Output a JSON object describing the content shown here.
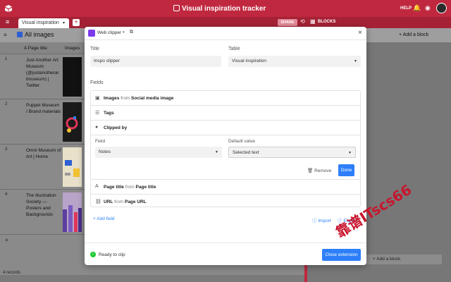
{
  "app": {
    "base_title": "Visual inspiration tracker",
    "help": "HELP"
  },
  "tabs": {
    "table_name": "Visual inspiration",
    "share_label": "SHARE",
    "blocks_label": "BLOCKS"
  },
  "view": {
    "name": "All images",
    "add_block": "Add a block"
  },
  "grid": {
    "col_title": "Page title",
    "col_images": "Images",
    "rows": [
      {
        "num": "1",
        "title": "Just Another Art Museum (@justanotherar tmuseum) | Twitter"
      },
      {
        "num": "2",
        "title": "Puppet Museum / Brand materials"
      },
      {
        "num": "3",
        "title": "Omni Museum of Art | Home"
      },
      {
        "num": "4",
        "title": "The Illustration Society — Posters and Backgrounds"
      }
    ],
    "record_count": "4 records",
    "add_row": "+"
  },
  "blocks_panel": {
    "add_block": "Add a block"
  },
  "modal": {
    "extension_name": "Web clipper",
    "title_label": "Title",
    "title_value": "Inspo clipper",
    "table_label": "Table",
    "table_value": "Visual inspiration",
    "fields_label": "Fields",
    "fields": {
      "images": {
        "name": "Images",
        "from": "from",
        "source": "Social media image"
      },
      "tags": {
        "name": "Tags"
      },
      "clipped_by": {
        "name": "Clipped by"
      },
      "page_title": {
        "name": "Page title",
        "from": "from",
        "source": "Page title"
      },
      "url": {
        "name": "URL",
        "from": "from",
        "source": "Page URL"
      }
    },
    "edit": {
      "field_label": "Field",
      "field_value": "Notes",
      "default_label": "Default value",
      "default_value": "Selected text",
      "remove": "Remove",
      "done": "Done"
    },
    "add_field": "Add field",
    "import": "Import",
    "export": "Export",
    "status": "Ready to clip",
    "close_button": "Close extension"
  },
  "watermark": "靠谱ITscs66",
  "colors": {
    "brand": "#c0283f",
    "accent": "#2d7ff9",
    "success": "#20c933"
  }
}
